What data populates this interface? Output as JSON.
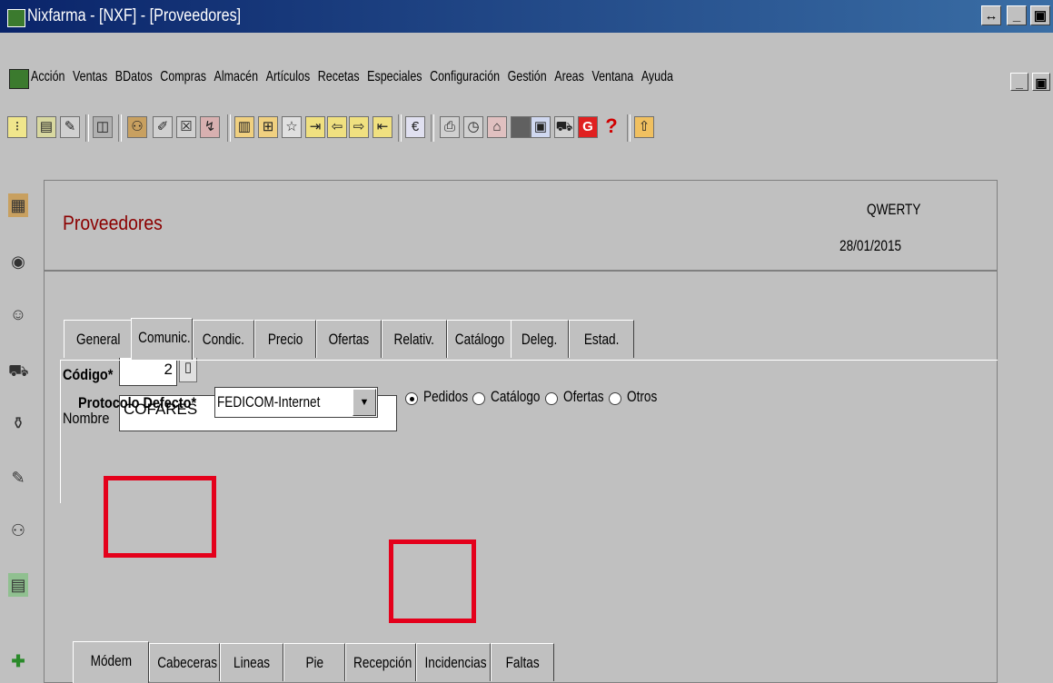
{
  "window": {
    "title": "Nixfarma - [NXF] - [Proveedores]",
    "ctl_resize": "↔",
    "ctl_min": "_",
    "ctl_max": "▣"
  },
  "menu": {
    "items": [
      "Acción",
      "Ventas",
      "BDatos",
      "Compras",
      "Almacén",
      "Artículos",
      "Recetas",
      "Especiales",
      "Configuración",
      "Gestión",
      "Areas",
      "Ventana",
      "Ayuda"
    ]
  },
  "toolbar": {
    "icons": [
      "list-icon",
      "form-icon",
      "edit-icon",
      "disabled-icon",
      "binoculars-icon",
      "notes-icon",
      "delete-icon",
      "export-icon",
      "report-icon",
      "tree-icon",
      "star-icon",
      "next-record-icon",
      "arrow-left-icon",
      "arrow-right-icon",
      "import-icon",
      "euro-icon",
      "print-icon",
      "clock-icon",
      "lock-icon",
      "stop-icon",
      "computer-icon",
      "cart-icon",
      "g-icon",
      "help-icon",
      "exit-icon"
    ],
    "euro_glyph": "€",
    "help_glyph": "?",
    "g_glyph": "G"
  },
  "sidebar": {
    "icons": [
      "book-icon",
      "coin-icon",
      "person-icon",
      "cart-icon",
      "basket-icon",
      "pencil-icon",
      "people-icon",
      "computer-icon",
      "add-icon"
    ]
  },
  "header": {
    "title": "Proveedores",
    "user": "QWERTY",
    "date": "28/01/2015"
  },
  "form": {
    "codigo_label": "Código*",
    "codigo_value": "2",
    "nombre_label": "Nombre",
    "nombre_value": "COFARES"
  },
  "tabs": [
    "General",
    "Comunic.",
    "Condic.",
    "Precio",
    "Ofertas",
    "Relativ.",
    "Catálogo",
    "Deleg.",
    "Estad."
  ],
  "comunic": {
    "protocolo_label": "Protocolo Defecto*",
    "protocolo_value": "FEDICOM-Internet",
    "radios": [
      {
        "label": "Pedidos",
        "checked": true
      },
      {
        "label": "Catálogo",
        "checked": false
      },
      {
        "label": "Ofertas",
        "checked": false
      },
      {
        "label": "Otros",
        "checked": false
      }
    ]
  },
  "subtabs": [
    "Módem",
    "Cabeceras",
    "Lineas",
    "Pie",
    "Recepción",
    "Incidencias",
    "Faltas"
  ],
  "colors": {
    "title_red": "#8b0000",
    "highlight": "#e4001b",
    "titlebar": "#0a246a"
  }
}
